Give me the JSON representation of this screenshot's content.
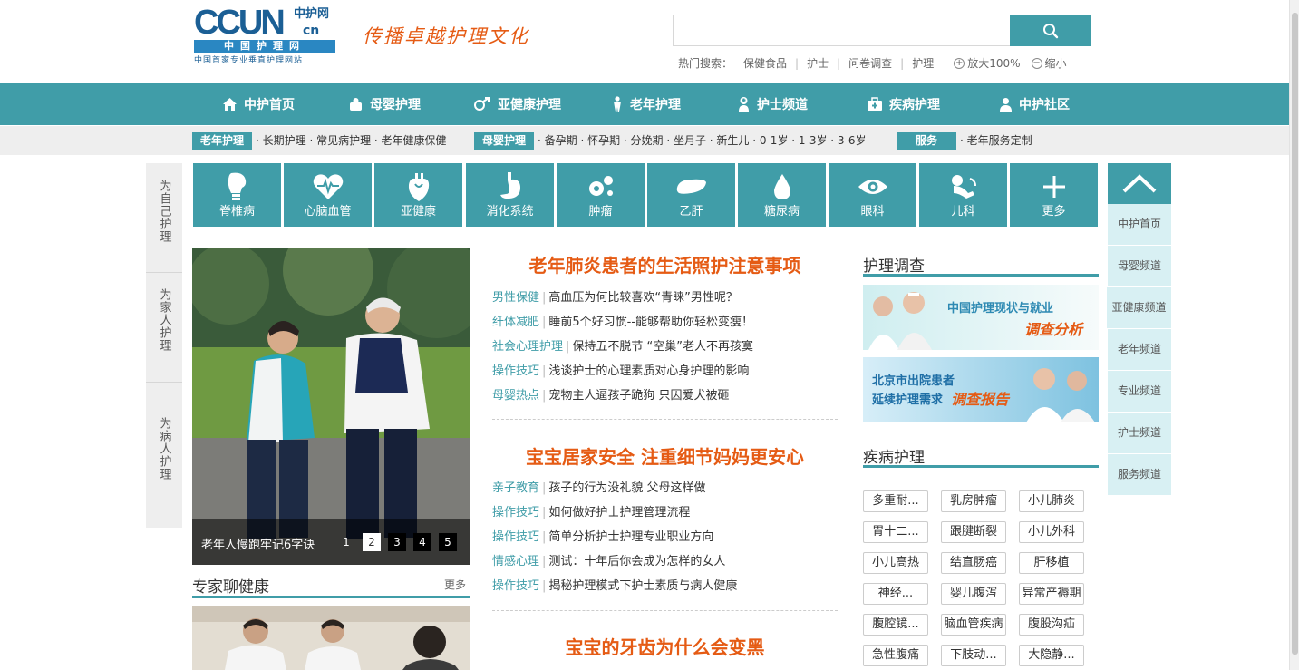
{
  "header": {
    "logo": {
      "ccun": "CCUN",
      "zhonghu": "中护网",
      "cn": "cn",
      "bar": "中国护理网",
      "sub": "中国首家专业垂直护理网站"
    },
    "slogan": "传播卓越护理文化",
    "search": {
      "placeholder": "",
      "value": ""
    },
    "hot_label": "热门搜索：",
    "hot_items": [
      "保健食品",
      "护士",
      "问卷调查",
      "护理"
    ],
    "zoom_in": "放大100%",
    "zoom_out": "缩小"
  },
  "main_nav": [
    {
      "label": "中护首页",
      "icon": "home-icon"
    },
    {
      "label": "母婴护理",
      "icon": "baby-icon"
    },
    {
      "label": "亚健康护理",
      "icon": "gender-icon"
    },
    {
      "label": "老年护理",
      "icon": "elderly-icon"
    },
    {
      "label": "护士频道",
      "icon": "nurse-icon"
    },
    {
      "label": "疾病护理",
      "icon": "medkit-icon"
    },
    {
      "label": "中护社区",
      "icon": "user-icon"
    }
  ],
  "sub_nav": [
    {
      "tag": "老年护理",
      "links": "· 长期护理 · 常见病护理 · 老年健康保健"
    },
    {
      "tag": "母婴护理",
      "links": "· 备孕期 · 怀孕期 · 分娩期 · 坐月子 · 新生儿 · 0-1岁 · 1-3岁 · 3-6岁"
    },
    {
      "tag": "服务",
      "links": "· 老年服务定制"
    }
  ],
  "side_tabs": [
    "为自己护理",
    "为家人护理",
    "为病人护理"
  ],
  "categories": [
    {
      "label": "脊椎病",
      "icon": "spine-icon"
    },
    {
      "label": "心脑血管",
      "icon": "heart-pulse-icon"
    },
    {
      "label": "亚健康",
      "icon": "heart-organ-icon"
    },
    {
      "label": "消化系统",
      "icon": "stomach-icon"
    },
    {
      "label": "肿瘤",
      "icon": "tumor-icon"
    },
    {
      "label": "乙肝",
      "icon": "liver-icon"
    },
    {
      "label": "糖尿病",
      "icon": "drop-icon"
    },
    {
      "label": "眼科",
      "icon": "eye-icon"
    },
    {
      "label": "儿科",
      "icon": "child-icon"
    },
    {
      "label": "更多",
      "icon": "plus-icon"
    }
  ],
  "right_nav": [
    "中护首页",
    "母婴频道",
    "亚健康频道",
    "老年频道",
    "专业频道",
    "护士频道",
    "服务频道"
  ],
  "slideshow": {
    "caption": "老年人慢跑牢记6字诀",
    "pages": [
      "1",
      "2",
      "3",
      "4",
      "5"
    ],
    "active": 2
  },
  "expert": {
    "title": "专家聊健康",
    "more": "更多"
  },
  "news": [
    {
      "headline": "老年肺炎患者的生活照护注意事项",
      "items": [
        {
          "cat": "男性保健",
          "title": "高血压为何比较喜欢“青睐”男性呢？"
        },
        {
          "cat": "纤体减肥",
          "title": "睡前5个好习惯--能够帮助你轻松变瘦！"
        },
        {
          "cat": "社会心理护理",
          "title": "保持五不脱节 “空巢”老人不再孩寞"
        },
        {
          "cat": "操作技巧",
          "title": "浅谈护士的心理素质对心身护理的影响"
        },
        {
          "cat": "母婴热点",
          "title": "宠物主人逼孩子跪狗 只因爱犬被砸"
        }
      ]
    },
    {
      "headline": "宝宝居家安全 注重细节妈妈更安心",
      "items": [
        {
          "cat": "亲子教育",
          "title": "孩子的行为没礼貌 父母这样做"
        },
        {
          "cat": "操作技巧",
          "title": "如何做好护士护理管理流程"
        },
        {
          "cat": "操作技巧",
          "title": "简单分析护士护理专业职业方向"
        },
        {
          "cat": "情感心理",
          "title": "测试：十年后你会成为怎样的女人"
        },
        {
          "cat": "操作技巧",
          "title": "揭秘护理模式下护士素质与病人健康"
        }
      ]
    },
    {
      "headline": "宝宝的牙齿为什么会变黑",
      "items": []
    }
  ],
  "survey": {
    "title": "护理调查",
    "banner1": {
      "line1": "中国护理现状与就业",
      "line2": "调查分析"
    },
    "banner2": {
      "line1": "北京市出院患者",
      "line2": "延续护理需求",
      "line3": "调查报告"
    }
  },
  "disease": {
    "title": "疾病护理",
    "tags": [
      [
        "多重耐...",
        "乳房肿瘤",
        "小儿肺炎"
      ],
      [
        "胃十二...",
        "跟腱断裂",
        "小儿外科"
      ],
      [
        "小儿高热",
        "结直肠癌",
        "肝移植"
      ],
      [
        "神经...",
        "婴儿腹泻",
        "异常产褥期"
      ],
      [
        "腹腔镜...",
        "脑血管疾病",
        "腹股沟疝"
      ],
      [
        "急性腹痛",
        "下肢动...",
        "大隐静..."
      ]
    ]
  },
  "colors": {
    "accent": "#409da8",
    "headline": "#e55b14",
    "logo_blue": "#1b5f95",
    "light_panel": "#d8f0f3"
  }
}
